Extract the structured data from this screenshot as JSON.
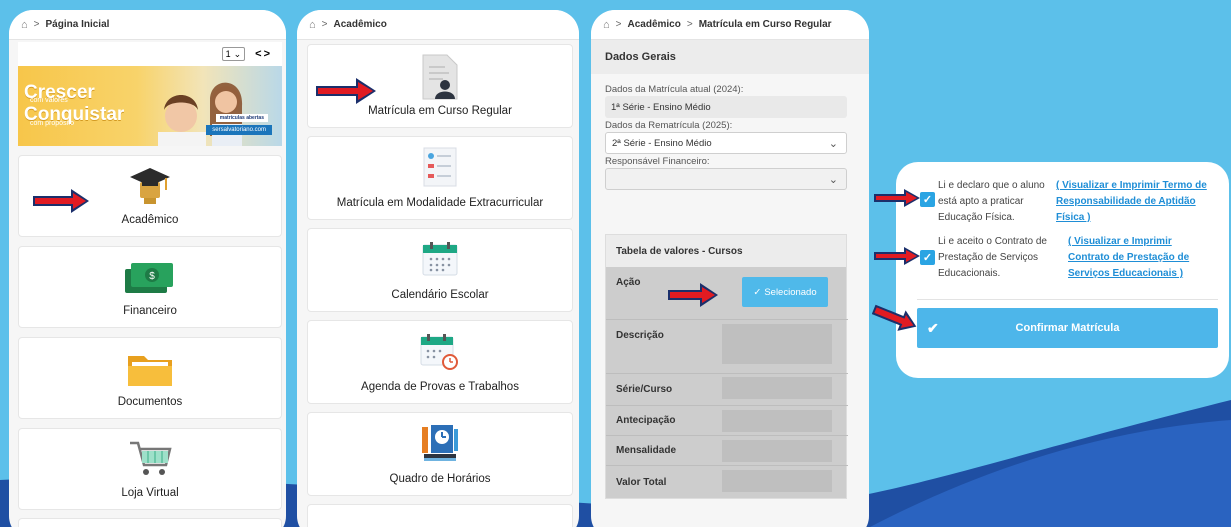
{
  "colors": {
    "accent": "#4db6ea",
    "background": "#5cc0ea",
    "arrow": "#e11b22",
    "check": "#2aa4e3"
  },
  "screen1": {
    "breadcrumb": {
      "home_icon": "home-icon",
      "page": "Página Inicial"
    },
    "banner": {
      "page_select": "1",
      "line1": "Crescer",
      "line2": "com valores",
      "line3": "Conquistar",
      "line4": "com propósito",
      "tag": "matrículas abertas",
      "site": "sersalvatoriano.com"
    },
    "menu": [
      {
        "label": "Acadêmico",
        "icon": "graduation-cap-icon"
      },
      {
        "label": "Financeiro",
        "icon": "money-icon"
      },
      {
        "label": "Documentos",
        "icon": "folder-icon"
      },
      {
        "label": "Loja Virtual",
        "icon": "shopping-cart-icon"
      }
    ]
  },
  "screen2": {
    "breadcrumb": {
      "home_icon": "home-icon",
      "page": "Acadêmico"
    },
    "menu": [
      {
        "label": "Matrícula em Curso Regular",
        "icon": "enrollment-document-icon"
      },
      {
        "label": "Matrícula em Modalidade Extracurricular",
        "icon": "list-document-icon"
      },
      {
        "label": "Calendário Escolar",
        "icon": "calendar-icon"
      },
      {
        "label": "Agenda de Provas e Trabalhos",
        "icon": "calendar-clock-icon"
      },
      {
        "label": "Quadro de Horários",
        "icon": "schedule-board-icon"
      }
    ]
  },
  "screen3": {
    "breadcrumb": {
      "home_icon": "home-icon",
      "level1": "Acadêmico",
      "level2": "Matrícula em Curso Regular"
    },
    "section_title": "Dados Gerais",
    "current_label": "Dados da Matrícula atual (2024):",
    "current_value": "1ª Série - Ensino Médio",
    "renewal_label": "Dados da Rematrícula (2025):",
    "renewal_value": "2ª Série - Ensino Médio",
    "guardian_label": "Responsável Financeiro:",
    "guardian_value": "",
    "table_title": "Tabela de valores - Cursos",
    "rows": {
      "acao": "Ação",
      "selected_button": "Selecionado",
      "descricao": "Descrição",
      "serie": "Série/Curso",
      "antecipacao": "Antecipação",
      "mensalidade": "Mensalidade",
      "valor_total": "Valor Total"
    }
  },
  "screen4": {
    "check1_text_a": "Li e declaro que o aluno",
    "check1_text_b": "está apto a praticar",
    "check1_text_c": "Educação Física.",
    "check1_link_a": "( Visualizar e Imprimir Termo de",
    "check1_link_b": "Responsabilidade de Aptidão",
    "check1_link_c": "Física )",
    "check2_text_a": "Li e aceito o Contrato de",
    "check2_text_b": "Prestação de Serviços",
    "check2_text_c": "Educacionais.",
    "check2_link_a": "( Visualizar e Imprimir",
    "check2_link_b": "Contrato de Prestação de",
    "check2_link_c": "Serviços Educacionais )",
    "confirm_label": "Confirmar Matrícula"
  }
}
